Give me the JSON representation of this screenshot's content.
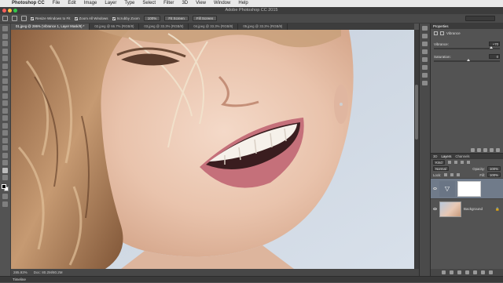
{
  "menubar": {
    "items": [
      "Photoshop CC",
      "File",
      "Edit",
      "Image",
      "Layer",
      "Type",
      "Select",
      "Filter",
      "3D",
      "View",
      "Window",
      "Help"
    ]
  },
  "window": {
    "title": "Adobe Photoshop CC 2015"
  },
  "options": {
    "resize_label": "Resize Windows to Fit",
    "zoom_all_label": "Zoom All Windows",
    "scrubby_label": "Scrubby Zoom",
    "zoom_pct": "100%",
    "fit_screen": "Fit Screen",
    "fill_screen": "Fill Screen"
  },
  "tabs": [
    "01.jpeg @ 286% (Vibrance 1, Layer Mask/8) *",
    "02.jpeg @ 66.7% (RGB/8)",
    "03.jpeg @ 33.3% (RGB/8)",
    "04.jpeg @ 33.3% (RGB/8)",
    "05.jpeg @ 33.3% (RGB/8)"
  ],
  "status": {
    "zoom": "285.93%",
    "doc": "Doc: 80.2M/80.2M"
  },
  "timeline": {
    "label": "Timeline"
  },
  "properties": {
    "tab": "Properties",
    "title": "Vibrance",
    "vibrance_label": "Vibrance:",
    "vibrance_value": "+70",
    "vibrance_level": 0.85,
    "saturation_label": "Saturation:",
    "saturation_value": "0",
    "saturation_level": 0.5
  },
  "layers_panel": {
    "tabs": [
      "3D",
      "Layers",
      "Channels"
    ],
    "kind": "Kind",
    "blend": "Normal",
    "opacity_label": "Opacity:",
    "opacity": "100%",
    "lock_label": "Lock:",
    "fill_label": "Fill:",
    "fill": "100%",
    "layers": [
      {
        "name": "",
        "type": "vibrance-adjustment"
      },
      {
        "name": "Background",
        "type": "image"
      }
    ]
  },
  "colors": {
    "ui_dark": "#535353",
    "accent_layer": "#707b8a",
    "traffic_red": "#fc605c",
    "traffic_yellow": "#fdbc40",
    "traffic_green": "#34c84a"
  }
}
